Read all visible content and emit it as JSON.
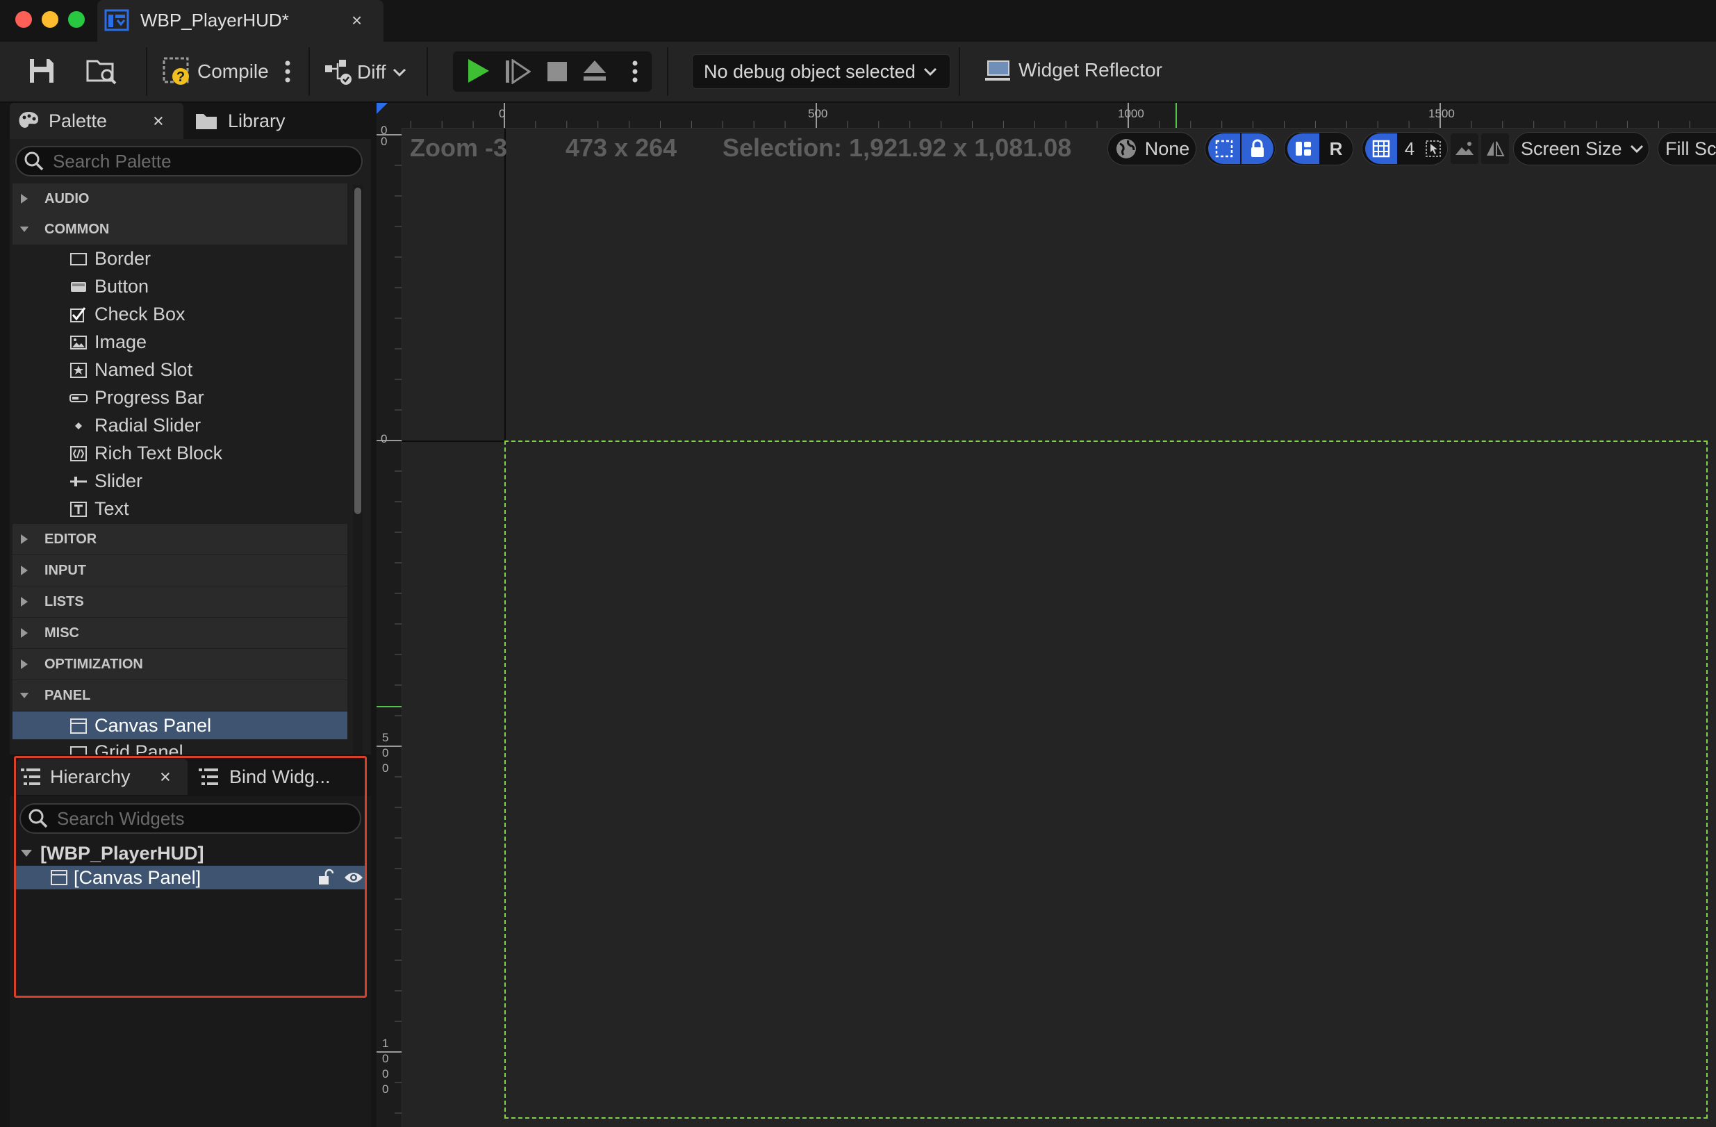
{
  "window": {
    "tab_title": "WBP_PlayerHUD*",
    "tab_close": "×"
  },
  "toolbar": {
    "compile_label": "Compile",
    "diff_label": "Diff",
    "debug_dropdown": "No debug object selected",
    "reflector_label": "Widget Reflector"
  },
  "palette": {
    "tab_label": "Palette",
    "tab_close": "×",
    "library_tab": "Library",
    "search_placeholder": "Search Palette",
    "categories": {
      "audio": "AUDIO",
      "common": "COMMON",
      "editor": "EDITOR",
      "input": "INPUT",
      "lists": "LISTS",
      "misc": "MISC",
      "optimization": "OPTIMIZATION",
      "panel": "PANEL"
    },
    "common_items": [
      "Border",
      "Button",
      "Check Box",
      "Image",
      "Named Slot",
      "Progress Bar",
      "Radial Slider",
      "Rich Text Block",
      "Slider",
      "Text"
    ],
    "panel_items": [
      "Canvas Panel",
      "Grid Panel"
    ]
  },
  "hierarchy": {
    "tab_label": "Hierarchy",
    "tab_close": "×",
    "bind_tab": "Bind Widg...",
    "search_placeholder": "Search Widgets",
    "root": "[WBP_PlayerHUD]",
    "child": "[Canvas Panel]",
    "highlight_color": "#d8402a"
  },
  "designer": {
    "zoom": "Zoom -3",
    "size": "473 x 264",
    "selection": "Selection: 1,921.92 x 1,081.08",
    "ruler_h": [
      "0",
      "500",
      "1000",
      "1500"
    ],
    "ruler_v_top": "0",
    "ruler_v_0": "0",
    "ruler_v_500": [
      "5",
      "0",
      "0"
    ],
    "ruler_v_1000": [
      "1",
      "0",
      "0",
      "0"
    ],
    "ruler_v_partial": "0",
    "localization": "None",
    "grid_snap_value": "4",
    "screen_size_label": "Screen Size",
    "fill_label": "Fill Sc",
    "r_label": "R",
    "canvas_border_color": "#7fd44a"
  }
}
